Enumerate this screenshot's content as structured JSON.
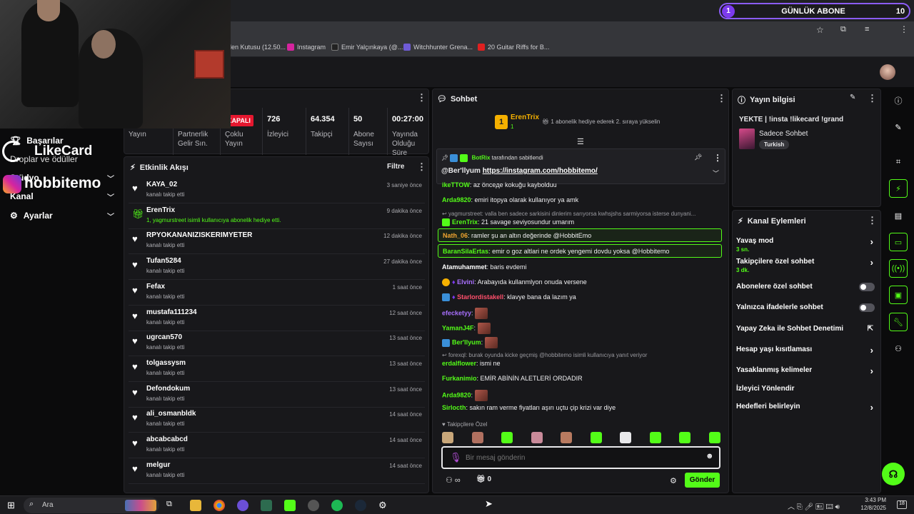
{
  "goal": {
    "index": "1",
    "title": "GÜNLÜK ABONE",
    "target": "10"
  },
  "bookmarks": [
    {
      "label": "llen Kutusu (12.50...",
      "color": "#444"
    },
    {
      "label": "Instagram",
      "color": "#d6249f"
    },
    {
      "label": "Emir Yalçınkaya (@...",
      "color": "#222"
    },
    {
      "label": "Witchhunter Grena...",
      "color": "#6f5bd6"
    },
    {
      "label": "20 Guitar Riffs for B...",
      "color": "#e02020"
    }
  ],
  "overlay": {
    "likecard": "LikeCard",
    "instagram": "hobbitemo"
  },
  "leftnav": {
    "items": [
      {
        "label": "Başarılar"
      },
      {
        "label": "Droplar ve ödüller"
      },
      {
        "label": "Stüdyo"
      },
      {
        "label": "Kanal"
      },
      {
        "label": "Ayarlar"
      }
    ]
  },
  "stats": {
    "status": "KAPALI",
    "cols": [
      {
        "value": "",
        "label": "Yayın"
      },
      {
        "value": "",
        "label": "Partnerlik Gelir Sın."
      },
      {
        "value": "",
        "label": "Çoklu Yayın"
      },
      {
        "value": "726",
        "label": "İzleyici"
      },
      {
        "value": "64.354",
        "label": "Takipçi"
      },
      {
        "value": "50",
        "label": "Abone Sayısı"
      },
      {
        "value": "00:27:00",
        "label": "Yayında Olduğu Süre"
      }
    ]
  },
  "activity": {
    "title": "Etkinlik Akışı",
    "filter": "Filtre",
    "rows": [
      {
        "name": "KAYA_02",
        "sub": "kanalı takip etti",
        "time": "3 saniye önce",
        "kind": "follow"
      },
      {
        "name": "ErenTrix",
        "sub": "1, yagmurstreet isimli kullanıcıya abonelik hediye etti.",
        "time": "9 dakika önce",
        "kind": "gift"
      },
      {
        "name": "RPYOKANANIZISKERIMYETER",
        "sub": "kanalı takip etti",
        "time": "12 dakika önce",
        "kind": "follow"
      },
      {
        "name": "Tufan5284",
        "sub": "kanalı takip etti",
        "time": "27 dakika önce",
        "kind": "follow"
      },
      {
        "name": "Fefax",
        "sub": "kanalı takip etti",
        "time": "1 saat önce",
        "kind": "follow"
      },
      {
        "name": "mustafa111234",
        "sub": "kanalı takip etti",
        "time": "12 saat önce",
        "kind": "follow"
      },
      {
        "name": "ugrcan570",
        "sub": "kanalı takip etti",
        "time": "13 saat önce",
        "kind": "follow"
      },
      {
        "name": "tolgassysm",
        "sub": "kanalı takip etti",
        "time": "13 saat önce",
        "kind": "follow"
      },
      {
        "name": "Defondokum",
        "sub": "kanalı takip etti",
        "time": "13 saat önce",
        "kind": "follow"
      },
      {
        "name": "ali_osmanbldk",
        "sub": "kanalı takip etti",
        "time": "14 saat önce",
        "kind": "follow"
      },
      {
        "name": "abcabcabcd",
        "sub": "kanalı takip etti",
        "time": "14 saat önce",
        "kind": "follow"
      },
      {
        "name": "melgur",
        "sub": "kanalı takip etti",
        "time": "14 saat önce",
        "kind": "follow"
      }
    ]
  },
  "chat": {
    "title": "Sohbet",
    "top_gifter": {
      "name": "ErenTrix",
      "count": "1",
      "text": "1 abonelik hediye ederek 2. sıraya yükselin"
    },
    "pinned": {
      "by": "BotRix",
      "by_suffix": "tarafından sabitlendi",
      "author": "@Ber'llyum",
      "link": "https://instagram.com/hobbitemo/"
    },
    "messages": [
      {
        "user": "ikeTTOW",
        "text": "az önceде kokuğu kaybolduu",
        "color": "#53fc18"
      },
      {
        "user": "Arda9820",
        "text": "emiri itopya olarak kullanıyor ya amk",
        "color": "#53fc18"
      },
      {
        "reply": "yagmurstreet: valla ben sadece sarkisini dinlerim sarıyorsa kwhsjshs sarmiyorsa isterse dunyani..."
      },
      {
        "user": "ErenTrix",
        "text": "21 savage seviyosundur umarım",
        "color": "#53fc18"
      },
      {
        "user": "Nath_06",
        "text": "ramler şu an altın değerinde @HobbitEmo",
        "color": "#f2a531",
        "highlight": true
      },
      {
        "user": "BaranSilaErtas",
        "text": "emir o goz altlari ne ordek yengemi dovdu yoksa @Hobbitemo",
        "color": "#53fc18",
        "highlight": true
      },
      {
        "user": "Atamuhammet",
        "text": "baris evdemi",
        "color": "#ffffff"
      },
      {
        "user": "Elvini",
        "text": "Arabayıda kullanmlyon onuda versene",
        "color": "#a970ff"
      },
      {
        "user": "Starlordistakell",
        "text": "klavye bana da lazım ya",
        "color": "#ff4f6b"
      },
      {
        "user": "efecketyy",
        "text": "",
        "color": "#a970ff"
      },
      {
        "user": "YamanJ4F",
        "text": "",
        "color": "#53fc18"
      },
      {
        "user": "Ber'llyum",
        "text": "",
        "color": "#53fc18"
      },
      {
        "reply": "forexql: burak oyunda kicke geçmiş @hobbitemo isimli kullanıcıya yanıt veriyor"
      },
      {
        "user": "erdalflower",
        "text": "ismi ne",
        "color": "#53fc18"
      },
      {
        "user": "Furkanimio",
        "text": "EMİR ABİNİN ALETLERİ ORDADIR",
        "color": "#53fc18"
      },
      {
        "user": "Arda9820",
        "text": "",
        "color": "#53fc18"
      },
      {
        "user": "Sirlocth",
        "text": "sakın ram verme fiyatları aşırı uçtu çip krizi var diye",
        "color": "#53fc18"
      }
    ],
    "followers_only": "Takipçilere Özel",
    "input_placeholder": "Bir mesaj gönderin",
    "points": "0",
    "send": "Gönder"
  },
  "stream_info": {
    "title": "Yayın bilgisi",
    "stream_title": "YEKTE | !insta !likecard !grand",
    "category": "Sadece Sohbet",
    "tag": "Turkish"
  },
  "channel_actions": {
    "title": "Kanal Eylemleri",
    "items": [
      {
        "label": "Yavaş mod",
        "sub": "3 sn.",
        "control": "chevron"
      },
      {
        "label": "Takipçilere özel sohbet",
        "sub": "3 dk.",
        "control": "chevron"
      },
      {
        "label": "Abonelere özel sohbet",
        "sub": "",
        "control": "toggle"
      },
      {
        "label": "Yalnızca ifadelerle sohbet",
        "sub": "",
        "control": "toggle"
      },
      {
        "label": "Yapay Zeka ile Sohbet Denetimi",
        "sub": "",
        "control": "external"
      },
      {
        "label": "Hesap yaşı kısıtlaması",
        "sub": "",
        "control": "chevron"
      },
      {
        "label": "Yasaklanmış kelimeler",
        "sub": "",
        "control": "chevron"
      },
      {
        "label": "İzleyici Yönlendir",
        "sub": "",
        "control": "none"
      },
      {
        "label": "Hedefleri belirleyin",
        "sub": "",
        "control": "chevron"
      }
    ]
  },
  "taskbar": {
    "search": "Ara",
    "time": "3:43 PM",
    "date": "12/8/2025",
    "notif": "18"
  },
  "colors": {
    "accent": "#53fc18",
    "goal_border": "#8b5cf6",
    "live_red": "#e5172f"
  }
}
